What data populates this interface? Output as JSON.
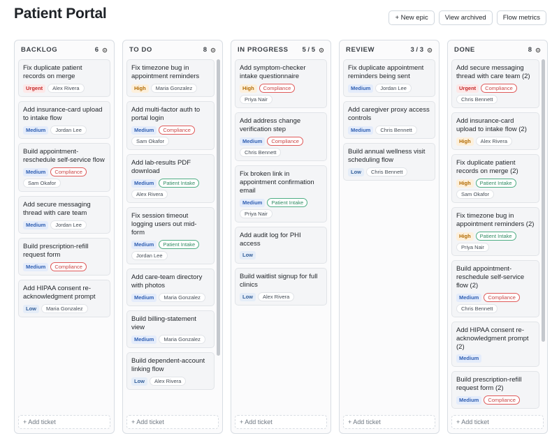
{
  "page": {
    "title": "Patient Portal"
  },
  "actions": {
    "new_epic": "+ New epic",
    "view_archived": "View archived",
    "flow_metrics": "Flow metrics"
  },
  "columns": [
    {
      "name": "BACKLOG",
      "count": "6",
      "cards": [
        {
          "title": "Fix duplicate patient records on merge",
          "priority": "Urgent",
          "labels": [],
          "assignee": "Alex Rivera"
        },
        {
          "title": "Add insurance-card upload to intake flow",
          "priority": "Medium",
          "labels": [],
          "assignee": "Jordan Lee"
        },
        {
          "title": "Build appointment-reschedule self-service flow",
          "priority": "Medium",
          "labels": [
            "Compliance"
          ],
          "assignee": "Sam Okafor"
        },
        {
          "title": "Add secure messaging thread with care team",
          "priority": "Medium",
          "labels": [],
          "assignee": "Jordan Lee"
        },
        {
          "title": "Build prescription-refill request form",
          "priority": "Medium",
          "labels": [
            "Compliance"
          ],
          "assignee": ""
        },
        {
          "title": "Add HIPAA consent re-acknowledgment prompt",
          "priority": "Low",
          "labels": [],
          "assignee": "Maria Gonzalez"
        }
      ],
      "add_label": "+ Add ticket",
      "scroll": null
    },
    {
      "name": "TO DO",
      "count": "8",
      "cards": [
        {
          "title": "Fix timezone bug in appointment reminders",
          "priority": "High",
          "labels": [],
          "assignee": "Maria Gonzalez"
        },
        {
          "title": "Add multi-factor auth to portal login",
          "priority": "Medium",
          "labels": [
            "Compliance"
          ],
          "assignee": "Sam Okafor"
        },
        {
          "title": "Add lab-results PDF download",
          "priority": "Medium",
          "labels": [
            "Patient Intake"
          ],
          "assignee": "Alex Rivera"
        },
        {
          "title": "Fix session timeout logging users out mid-form",
          "priority": "Medium",
          "labels": [
            "Patient Intake"
          ],
          "assignee": "Jordan Lee"
        },
        {
          "title": "Add care-team directory with photos",
          "priority": "Medium",
          "labels": [],
          "assignee": "Maria Gonzalez"
        },
        {
          "title": "Build billing-statement view",
          "priority": "Medium",
          "labels": [],
          "assignee": "Maria Gonzalez"
        },
        {
          "title": "Build dependent-account linking flow",
          "priority": "Low",
          "labels": [],
          "assignee": "Alex Rivera"
        }
      ],
      "add_label": "+ Add ticket",
      "scroll": {
        "start": 0.0,
        "size": 0.84
      }
    },
    {
      "name": "IN PROGRESS",
      "count": "5 / 5",
      "cards": [
        {
          "title": "Add symptom-checker intake questionnaire",
          "priority": "High",
          "labels": [
            "Compliance"
          ],
          "assignee": "Priya Nair"
        },
        {
          "title": "Add address change verification step",
          "priority": "Medium",
          "labels": [
            "Compliance"
          ],
          "assignee": "Chris Bennett"
        },
        {
          "title": "Fix broken link in appointment confirmation email",
          "priority": "Medium",
          "labels": [
            "Patient Intake"
          ],
          "assignee": "Priya Nair"
        },
        {
          "title": "Add audit log for PHI access",
          "priority": "Low",
          "labels": [],
          "assignee": ""
        },
        {
          "title": "Build waitlist signup for full clinics",
          "priority": "Low",
          "labels": [],
          "assignee": "Alex Rivera"
        }
      ],
      "add_label": "+ Add ticket",
      "scroll": null
    },
    {
      "name": "REVIEW",
      "count": "3 / 3",
      "cards": [
        {
          "title": "Fix duplicate appointment reminders being sent",
          "priority": "Medium",
          "labels": [],
          "assignee": "Jordan Lee"
        },
        {
          "title": "Add caregiver proxy access controls",
          "priority": "Medium",
          "labels": [],
          "assignee": "Chris Bennett"
        },
        {
          "title": "Build annual wellness visit scheduling flow",
          "priority": "Low",
          "labels": [],
          "assignee": "Chris Bennett"
        }
      ],
      "add_label": "+ Add ticket",
      "scroll": null
    },
    {
      "name": "DONE",
      "count": "8",
      "cards": [
        {
          "title": "Add secure messaging thread with care team (2)",
          "priority": "Urgent",
          "labels": [
            "Compliance"
          ],
          "assignee": "Chris Bennett"
        },
        {
          "title": "Add insurance-card upload to intake flow (2)",
          "priority": "High",
          "labels": [],
          "assignee": "Alex Rivera"
        },
        {
          "title": "Fix duplicate patient records on merge (2)",
          "priority": "High",
          "labels": [
            "Patient Intake"
          ],
          "assignee": "Sam Okafor"
        },
        {
          "title": "Fix timezone bug in appointment reminders (2)",
          "priority": "High",
          "labels": [
            "Patient Intake"
          ],
          "assignee": "Priya Nair"
        },
        {
          "title": "Build appointment-reschedule self-service flow (2)",
          "priority": "Medium",
          "labels": [
            "Compliance"
          ],
          "assignee": "Chris Bennett"
        },
        {
          "title": "Add HIPAA consent re-acknowledgment prompt (2)",
          "priority": "Medium",
          "labels": [],
          "assignee": ""
        },
        {
          "title": "Build prescription-refill request form (2)",
          "priority": "Medium",
          "labels": [
            "Compliance"
          ],
          "assignee": ""
        }
      ],
      "add_label": "+ Add ticket",
      "scroll": {
        "start": 0.0,
        "size": 0.8
      }
    }
  ],
  "colors": {
    "urgent": "#c62828",
    "high": "#b26a00",
    "medium": "#2f5fb3",
    "compliance": "#e05a5a",
    "patient_intake": "#4fae84"
  },
  "icons": {
    "column_settings": "gear-icon"
  }
}
